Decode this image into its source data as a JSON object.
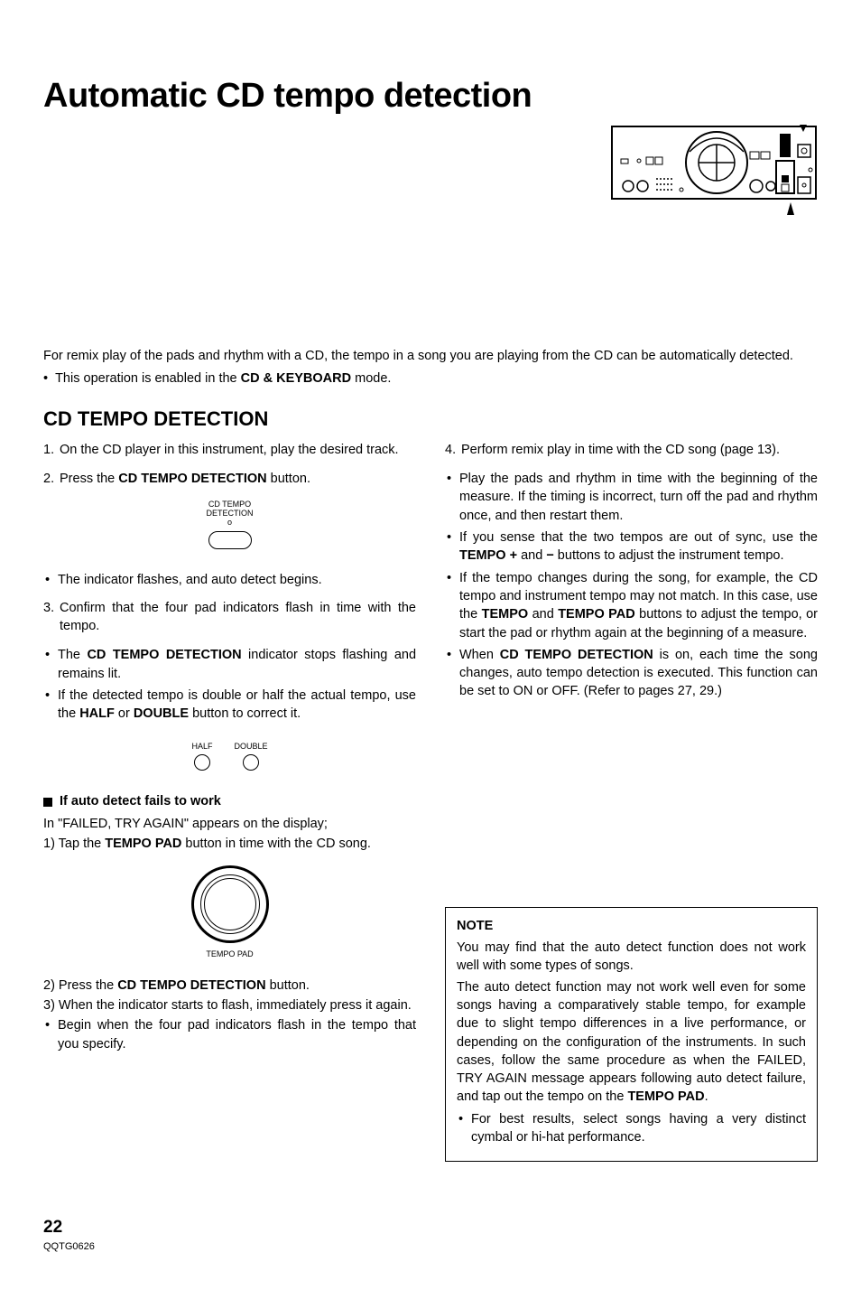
{
  "title": "Automatic CD tempo detection",
  "intro": {
    "p1": "For remix play of the pads and rhythm with a CD, the tempo in a song you are playing from the CD can be automatically detected.",
    "b1_pre": "This operation is enabled in the ",
    "b1_bold": "CD & KEYBOARD",
    "b1_post": " mode."
  },
  "section_heading": "CD TEMPO DETECTION",
  "left": {
    "s1_num": "1.",
    "s1": "On the CD player in this instrument, play the desired track.",
    "s2_num": "2.",
    "s2_pre": "Press the ",
    "s2_bold": "CD TEMPO DETECTION",
    "s2_post": " button.",
    "fig1_l1": "CD TEMPO",
    "fig1_l2": "DETECTION",
    "fig1_l3": "o",
    "b1": "The indicator flashes, and auto detect begins.",
    "s3_num": "3.",
    "s3": "Confirm that the four pad indicators flash in time with the tempo.",
    "s3b1_pre": "The ",
    "s3b1_bold": "CD TEMPO DETECTION",
    "s3b1_post": " indicator stops flashing and remains lit.",
    "s3b2_pre": "If the detected tempo is double or half the actual tempo, use the ",
    "s3b2_bold1": "HALF",
    "s3b2_mid": " or ",
    "s3b2_bold2": "DOUBLE",
    "s3b2_post": " button to correct it.",
    "fig2_half": "HALF",
    "fig2_double": "DOUBLE",
    "subhead": "If auto detect fails to work",
    "fail_l1": "In \"FAILED, TRY AGAIN\" appears on the display;",
    "fail_l2_pre": "1) Tap the ",
    "fail_l2_bold": "TEMPO PAD",
    "fail_l2_post": " button in time with the CD song.",
    "fig3_label": "TEMPO PAD",
    "fail_l3_pre": "2) Press the ",
    "fail_l3_bold": "CD TEMPO DETECTION",
    "fail_l3_post": " button.",
    "fail_l4": "3) When the indicator starts to flash, immediately press it again.",
    "fail_b1": "Begin when the four pad indicators flash in the tempo that you specify."
  },
  "right": {
    "s4_num": "4.",
    "s4": "Perform remix play in time with the CD song (page 13).",
    "b1": "Play the pads and rhythm in time with the beginning of the measure. If the timing is incorrect, turn off the pad and rhythm once, and then restart them.",
    "b2_pre": "If you sense that the two tempos are out of sync, use the ",
    "b2_bold1": "TEMPO +",
    "b2_mid": " and ",
    "b2_bold2": "−",
    "b2_post": " buttons to adjust the instrument tempo.",
    "b3_pre": "If the tempo changes during the song, for example, the CD tempo and instrument tempo may not match. In this case, use the ",
    "b3_bold1": "TEMPO",
    "b3_mid": " and ",
    "b3_bold2": "TEMPO PAD",
    "b3_post": " buttons to adjust the tempo, or start the pad or rhythm again at the beginning of a measure.",
    "b4_pre": "When ",
    "b4_bold": "CD TEMPO DETECTION",
    "b4_post": " is on, each time the song changes, auto tempo detection is executed. This function can be set to ON or OFF. (Refer to pages 27, 29.)"
  },
  "note": {
    "title": "NOTE",
    "p1": "You may find that the auto detect function does not work well with some types of songs.",
    "p2_pre": "The auto detect function may not work well even for some songs having a comparatively stable tempo, for example due to slight tempo differences in a live performance, or depending on the configuration of the instruments. In such cases, follow the same procedure as when the FAILED, TRY AGAIN message appears following auto detect failure, and tap out the tempo on the ",
    "p2_bold": "TEMPO PAD",
    "p2_post": ".",
    "b1": "For best results, select songs having a very distinct cymbal or hi-hat performance."
  },
  "footer": {
    "page": "22",
    "code": "QQTG0626"
  }
}
